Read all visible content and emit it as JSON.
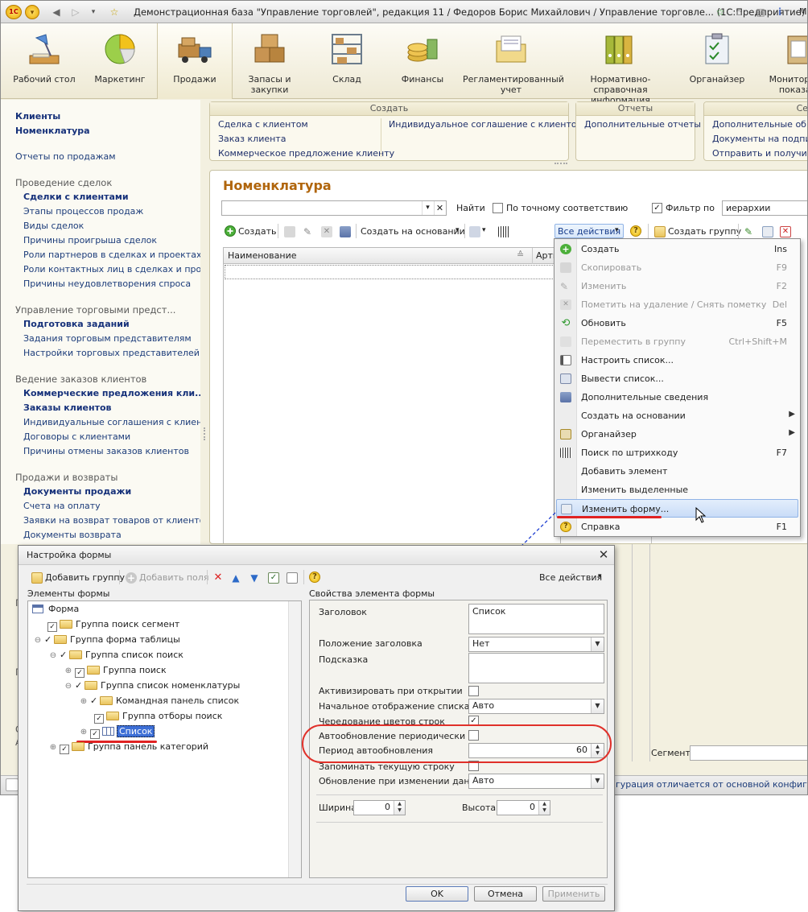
{
  "window": {
    "title": "Демонстрационная база \"Управление торговлей\", редакция 11 / Федоров Борис Михайлович /  Управление торговле... (1С:Предприятие)",
    "title_tail": "М",
    "app_badge": "1С"
  },
  "sections": [
    {
      "label": "Рабочий стол",
      "icon": "desk-lamp-icon"
    },
    {
      "label": "Маркетинг",
      "icon": "pie-chart-icon"
    },
    {
      "label": "Продажи",
      "icon": "delivery-truck-icon"
    },
    {
      "label": "Запасы и закупки",
      "icon": "cardboard-boxes-icon"
    },
    {
      "label": "Склад",
      "icon": "warehouse-shelves-icon"
    },
    {
      "label": "Финансы",
      "icon": "coins-icon"
    },
    {
      "label": "Регламентированный учет",
      "icon": "reports-folder-icon"
    },
    {
      "label": "Нормативно-справочная информация",
      "icon": "binders-icon"
    },
    {
      "label": "Органайзер",
      "icon": "clipboard-icon"
    },
    {
      "label": "Мониторинг показат",
      "icon": "monitor-icon"
    }
  ],
  "leftnav": {
    "top_links": [
      "Клиенты",
      "Номенклатура"
    ],
    "reports_link": "Отчеты по продажам",
    "groups": [
      {
        "header": "Проведение сделок",
        "items": [
          {
            "label": "Сделки с клиентами",
            "bold": true
          },
          {
            "label": "Этапы процессов продаж"
          },
          {
            "label": "Виды сделок"
          },
          {
            "label": "Причины проигрыша сделок"
          },
          {
            "label": "Роли партнеров в сделках и проектах"
          },
          {
            "label": "Роли контактных лиц в сделках и прое..."
          },
          {
            "label": "Причины неудовлетворения спроса"
          }
        ]
      },
      {
        "header": "Управление торговыми предст...",
        "items": [
          {
            "label": "Подготовка заданий",
            "bold": true
          },
          {
            "label": "Задания торговым представителям"
          },
          {
            "label": "Настройки торговых представителей"
          }
        ]
      },
      {
        "header": "Ведение заказов клиентов",
        "items": [
          {
            "label": "Коммерческие предложения кли...",
            "bold": true
          },
          {
            "label": "Заказы клиентов",
            "bold": true
          },
          {
            "label": "Индивидуальные соглашения с клиент..."
          },
          {
            "label": "Договоры с клиентами"
          },
          {
            "label": "Причины отмены заказов клиентов"
          }
        ]
      },
      {
        "header": "Продажи и возвраты",
        "items": [
          {
            "label": "Документы продажи",
            "bold": true
          },
          {
            "label": "Счета на оплату"
          },
          {
            "label": "Заявки на возврат товаров от клиентов"
          },
          {
            "label": "Документы возврата"
          }
        ]
      }
    ],
    "stray": [
      "Г",
      "П",
      "О",
      "А"
    ]
  },
  "create_panel": {
    "title": "Создать",
    "items": [
      "Сделка с клиентом",
      "Заказ клиента",
      "Коммерческое предложение клиенту",
      "Индивидуальное соглашение с клиентом"
    ]
  },
  "reports_panel": {
    "title": "Отчеты",
    "items": [
      "Дополнительные отчеты"
    ]
  },
  "service_panel": {
    "title": "Сер",
    "items": [
      "Дополнительные обраб",
      "Документы на подпись",
      "Отправить и получить э"
    ]
  },
  "form": {
    "title": "Номенклатура",
    "find_label": "Найти",
    "exact_match_label": "По точному соответствию",
    "filter_label": "Фильтр по",
    "filter_value": "иерархии",
    "toolbar": {
      "create": "Создать",
      "create_based": "Создать на основании",
      "all_actions": "Все действия",
      "create_group": "Создать группу"
    },
    "grid_columns": [
      "Наименование",
      "Артик"
    ],
    "segment_label": "Сегмент:",
    "right_fragment": "1"
  },
  "menu": [
    {
      "label": "Создать",
      "key": "Ins",
      "icon": "plus-green-icon",
      "disabled": false
    },
    {
      "label": "Скопировать",
      "key": "F9",
      "icon": "copy-icon",
      "disabled": true
    },
    {
      "label": "Изменить",
      "key": "F2",
      "icon": "pencil-icon",
      "disabled": true
    },
    {
      "label": "Пометить на удаление / Снять пометку",
      "key": "Del",
      "icon": "delete-mark-icon",
      "disabled": true
    },
    {
      "label": "Обновить",
      "key": "F5",
      "icon": "refresh-icon",
      "disabled": false
    },
    {
      "label": "Переместить в группу",
      "key": "Ctrl+Shift+M",
      "icon": "move-icon",
      "disabled": true
    },
    {
      "label": "Настроить список...",
      "key": "",
      "icon": "list-settings-icon",
      "disabled": false
    },
    {
      "label": "Вывести список...",
      "key": "",
      "icon": "print-list-icon",
      "disabled": false
    },
    {
      "label": "Дополнительные сведения",
      "key": "",
      "icon": "info-doc-icon",
      "disabled": false
    },
    {
      "label": "Создать на основании",
      "key": "",
      "icon": "",
      "disabled": false,
      "submenu": true
    },
    {
      "label": "Органайзер",
      "key": "",
      "icon": "organizer-icon",
      "disabled": false,
      "submenu": true
    },
    {
      "label": "Поиск по штрихкоду",
      "key": "F7",
      "icon": "barcode-icon",
      "disabled": false
    },
    {
      "label": "Добавить элемент",
      "key": "",
      "icon": "",
      "disabled": false
    },
    {
      "label": "Изменить выделенные",
      "key": "",
      "icon": "",
      "disabled": false
    },
    {
      "label": "Изменить форму...",
      "key": "",
      "icon": "form-settings-icon",
      "disabled": false,
      "highlight": true
    },
    {
      "label": "Справка",
      "key": "F1",
      "icon": "help-icon",
      "disabled": false
    }
  ],
  "status": {
    "text": "гурация отличается от основной конфигурации"
  },
  "dialog": {
    "title": "Настройка формы",
    "toolbar": {
      "add_group": "Добавить группу",
      "add_fields": "Добавить поля",
      "all_actions": "Все действия"
    },
    "elements_header": "Элементы формы",
    "props_header": "Свойства элемента формы",
    "tree": [
      {
        "label": "Форма",
        "level": 0,
        "type": "form"
      },
      {
        "label": "Группа поиск сегмент",
        "level": 1,
        "checked": true
      },
      {
        "label": "Группа форма таблицы",
        "level": 1,
        "checked": true,
        "expanded": true
      },
      {
        "label": "Группа список поиск",
        "level": 2,
        "checked": true,
        "expanded": true
      },
      {
        "label": "Группа поиск",
        "level": 3,
        "checked": true
      },
      {
        "label": "Группа список номенклатуры",
        "level": 3,
        "checked": true,
        "expanded": true
      },
      {
        "label": "Командная панель список",
        "level": 4,
        "checked": true
      },
      {
        "label": "Группа отборы поиск",
        "level": 4,
        "checked": true
      },
      {
        "label": "Список",
        "level": 4,
        "checked": true,
        "selected": true,
        "type": "table"
      },
      {
        "label": "Группа панель категорий",
        "level": 1,
        "checked": true
      }
    ],
    "props": {
      "caption_label": "Заголовок",
      "caption_value": "Список",
      "caption_pos_label": "Положение заголовка",
      "caption_pos_value": "Нет",
      "hint_label": "Подсказка",
      "activate_label": "Активизировать при открытии",
      "initial_view_label": "Начальное отображение списка",
      "initial_view_value": "Авто",
      "alternate_label": "Чередование цветов строк",
      "auto_update_label": "Автообновление периодически",
      "period_label": "Период автообновления",
      "period_value": "60",
      "remember_row_label": "Запоминать текущую строку",
      "update_on_change_label": "Обновление при изменении данных",
      "update_on_change_value": "Авто",
      "width_label": "Ширина",
      "width_value": "0",
      "height_label": "Высота",
      "height_value": "0"
    },
    "buttons": {
      "ok": "OK",
      "cancel": "Отмена",
      "apply": "Применить"
    }
  },
  "colors": {
    "accent_red": "#e02222",
    "link_blue": "#1c3c7a",
    "title_orange": "#b0650c",
    "annotation_blue": "#1f3fd1"
  }
}
